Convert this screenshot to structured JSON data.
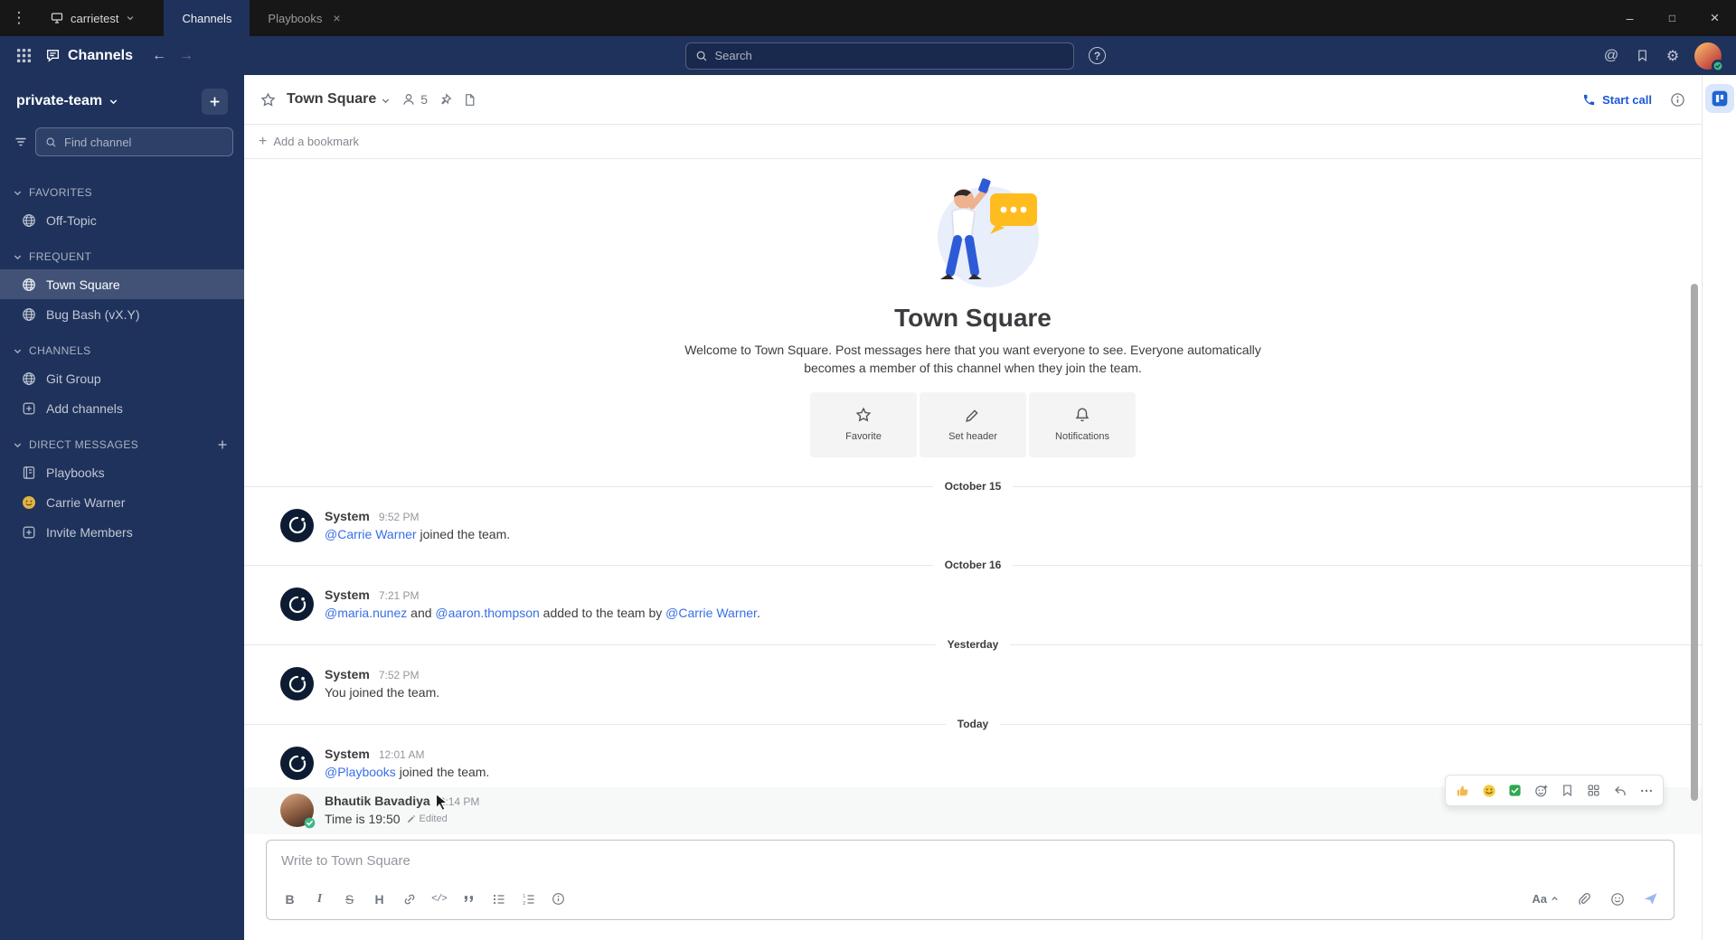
{
  "window": {
    "menu_glyph": "⋮",
    "server_name": "carrietest",
    "chevron_glyph": "⌄",
    "tabs": [
      {
        "label": "Channels",
        "active": true
      },
      {
        "label": "Playbooks",
        "active": false,
        "closable": true
      }
    ],
    "tab_close_glyph": "×",
    "controls": [
      {
        "name": "minimize",
        "glyph": "–"
      },
      {
        "name": "maximize",
        "glyph": "□"
      },
      {
        "name": "close",
        "glyph": "×"
      }
    ]
  },
  "header": {
    "product": "Channels",
    "back_glyph": "←",
    "forward_glyph": "→",
    "search_placeholder": "Search",
    "help_glyph": "?",
    "at_glyph": "@",
    "gear_glyph": "⚙"
  },
  "sidebar": {
    "team_name": "private-team",
    "find_placeholder": "Find channel",
    "sections": [
      {
        "title": "FAVORITES",
        "items": [
          {
            "label": "Off-Topic",
            "icon": "globe"
          }
        ]
      },
      {
        "title": "FREQUENT",
        "items": [
          {
            "label": "Town Square",
            "icon": "globe",
            "active": true
          },
          {
            "label": "Bug Bash (vX.Y)",
            "icon": "globe"
          }
        ]
      },
      {
        "title": "CHANNELS",
        "items": [
          {
            "label": "Git Group",
            "icon": "globe"
          },
          {
            "label": "Add channels",
            "icon": "plusbox"
          }
        ]
      },
      {
        "title": "DIRECT MESSAGES",
        "add_button": true,
        "items": [
          {
            "label": "Playbooks",
            "icon": "playbooks"
          },
          {
            "label": "Carrie Warner",
            "icon": "carrie"
          },
          {
            "label": "Invite Members",
            "icon": "plusbox"
          }
        ]
      }
    ]
  },
  "channel": {
    "name": "Town Square",
    "member_count": "5",
    "start_call_label": "Start call",
    "add_bookmark_label": "Add a bookmark"
  },
  "intro": {
    "title": "Town Square",
    "description": "Welcome to Town Square. Post messages here that you want everyone to see. Everyone automatically becomes a member of this channel when they join the team.",
    "actions": [
      "Favorite",
      "Set header",
      "Notifications"
    ]
  },
  "timeline": [
    {
      "type": "date",
      "label": "October 15"
    },
    {
      "type": "post",
      "sender": "System",
      "time": "9:52 PM",
      "avatar": "system",
      "segments": [
        {
          "kind": "mention",
          "text": "@Carrie Warner"
        },
        {
          "kind": "text",
          "text": " joined the team."
        }
      ]
    },
    {
      "type": "date",
      "label": "October 16"
    },
    {
      "type": "post",
      "sender": "System",
      "time": "7:21 PM",
      "avatar": "system",
      "segments": [
        {
          "kind": "mention",
          "text": "@maria.nunez"
        },
        {
          "kind": "text",
          "text": " and "
        },
        {
          "kind": "mention",
          "text": "@aaron.thompson"
        },
        {
          "kind": "text",
          "text": " added to the team by "
        },
        {
          "kind": "mention",
          "text": "@Carrie Warner"
        },
        {
          "kind": "text",
          "text": "."
        }
      ]
    },
    {
      "type": "date",
      "label": "Yesterday"
    },
    {
      "type": "post",
      "sender": "System",
      "time": "7:52 PM",
      "avatar": "system",
      "segments": [
        {
          "kind": "text",
          "text": "You joined the team."
        }
      ]
    },
    {
      "type": "date",
      "label": "Today"
    },
    {
      "type": "post",
      "sender": "System",
      "time": "12:01 AM",
      "avatar": "system",
      "segments": [
        {
          "kind": "mention",
          "text": "@Playbooks"
        },
        {
          "kind": "text",
          "text": " joined the team."
        }
      ]
    },
    {
      "type": "post",
      "sender": "Bhautik Bavadiya",
      "time": "2:14 PM",
      "avatar": "user",
      "highlight": true,
      "segments": [
        {
          "kind": "text",
          "text": "Time is 19:50"
        }
      ],
      "edited_label": "Edited",
      "toolbar": {
        "reactions": [
          "thumbsup",
          "smile",
          "white_check_mark"
        ],
        "actions": [
          "add-reaction",
          "save-message",
          "apps",
          "reply",
          "more"
        ]
      }
    }
  ],
  "composer": {
    "placeholder": "Write to Town Square",
    "format_buttons": [
      "bold",
      "italic",
      "strikethrough",
      "heading",
      "link",
      "code",
      "quote",
      "bulleted-list",
      "numbered-list",
      "help"
    ],
    "aa_label": "Aa"
  },
  "colors": {
    "titlebar_bg": "#171717",
    "sidebar_bg": "#1e325c",
    "accent_blue": "#1c58d9",
    "mention_blue": "#386fe5",
    "online_green": "#3db887"
  }
}
